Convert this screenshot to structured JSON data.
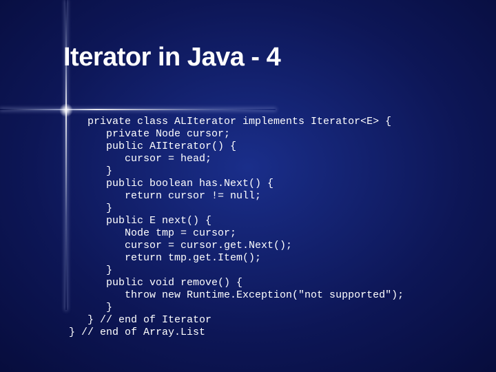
{
  "title": "Iterator in Java - 4",
  "code_lines": [
    "   private class ALIterator implements Iterator<E> {",
    "      private Node cursor;",
    "      public AIIterator() {",
    "         cursor = head;",
    "      }",
    "      public boolean has.Next() {",
    "         return cursor != null;",
    "      }",
    "      public E next() {",
    "         Node tmp = cursor;",
    "         cursor = cursor.get.Next();",
    "         return tmp.get.Item();",
    "      }",
    "      public void remove() {",
    "         throw new Runtime.Exception(\"not supported\");",
    "      }",
    "   } // end of Iterator",
    "} // end of Array.List"
  ]
}
